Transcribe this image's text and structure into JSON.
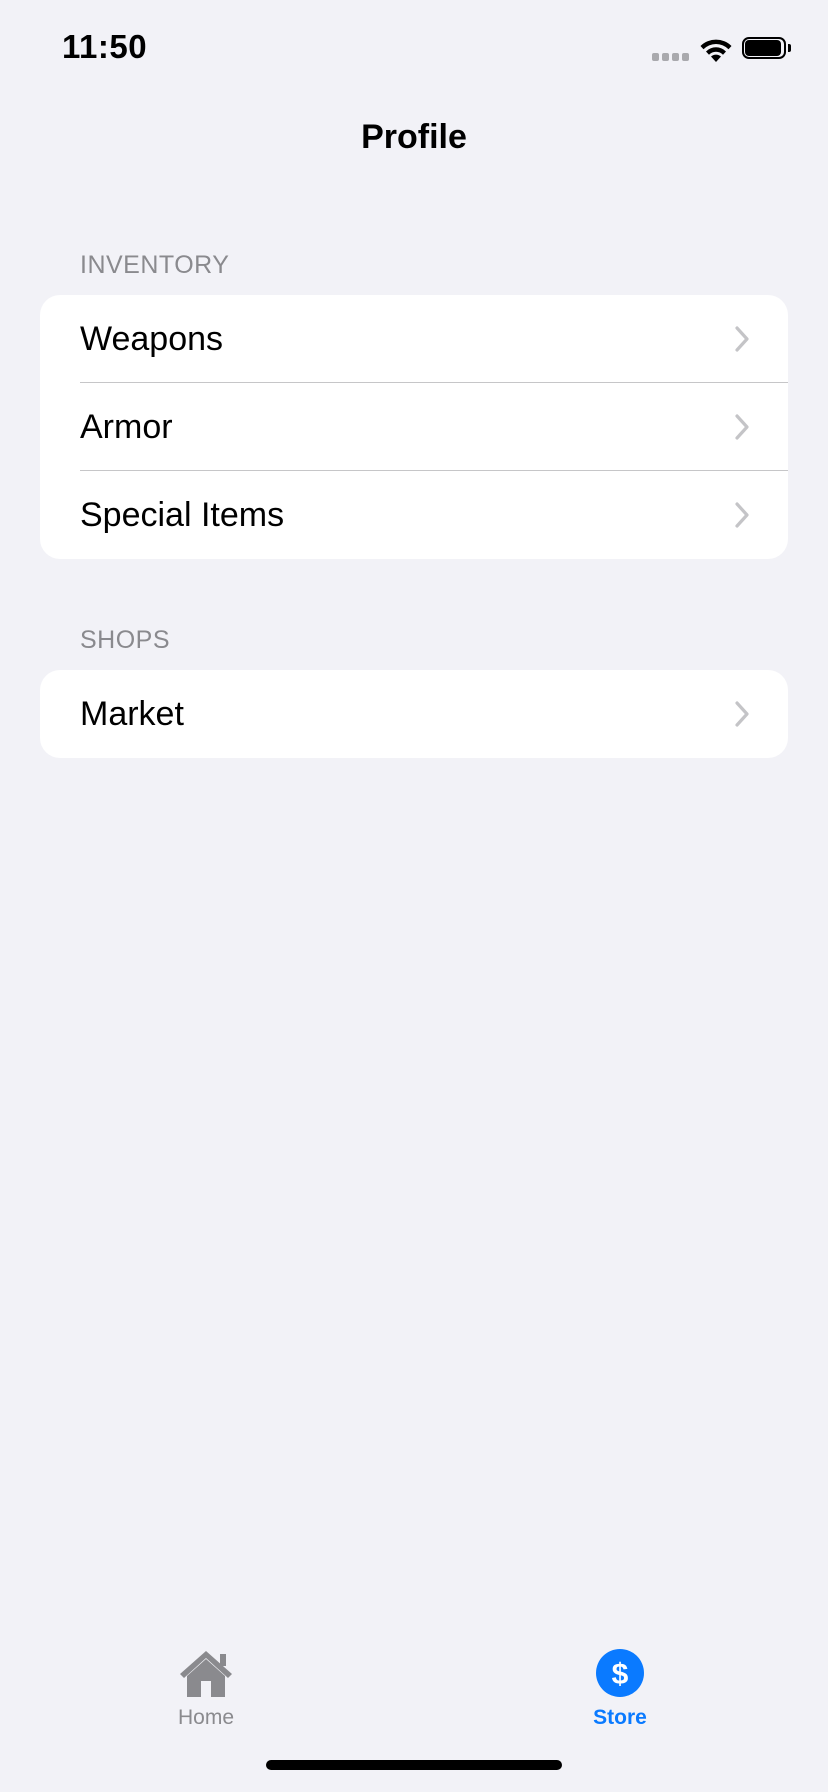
{
  "status_bar": {
    "time": "11:50"
  },
  "nav": {
    "title": "Profile"
  },
  "sections": [
    {
      "header": "INVENTORY",
      "rows": [
        {
          "label": "Weapons"
        },
        {
          "label": "Armor"
        },
        {
          "label": "Special Items"
        }
      ]
    },
    {
      "header": "SHOPS",
      "rows": [
        {
          "label": "Market"
        }
      ]
    }
  ],
  "tab_bar": {
    "tabs": [
      {
        "label": "Home",
        "icon": "house-icon",
        "selected": false
      },
      {
        "label": "Store",
        "icon": "dollar-circle-icon",
        "selected": true
      }
    ]
  },
  "colors": {
    "background": "#f2f2f7",
    "card": "#ffffff",
    "accent": "#0a7aff",
    "inactive": "#8a8a8e",
    "separator": "#c6c6c8",
    "chevron": "#c4c4c7"
  }
}
